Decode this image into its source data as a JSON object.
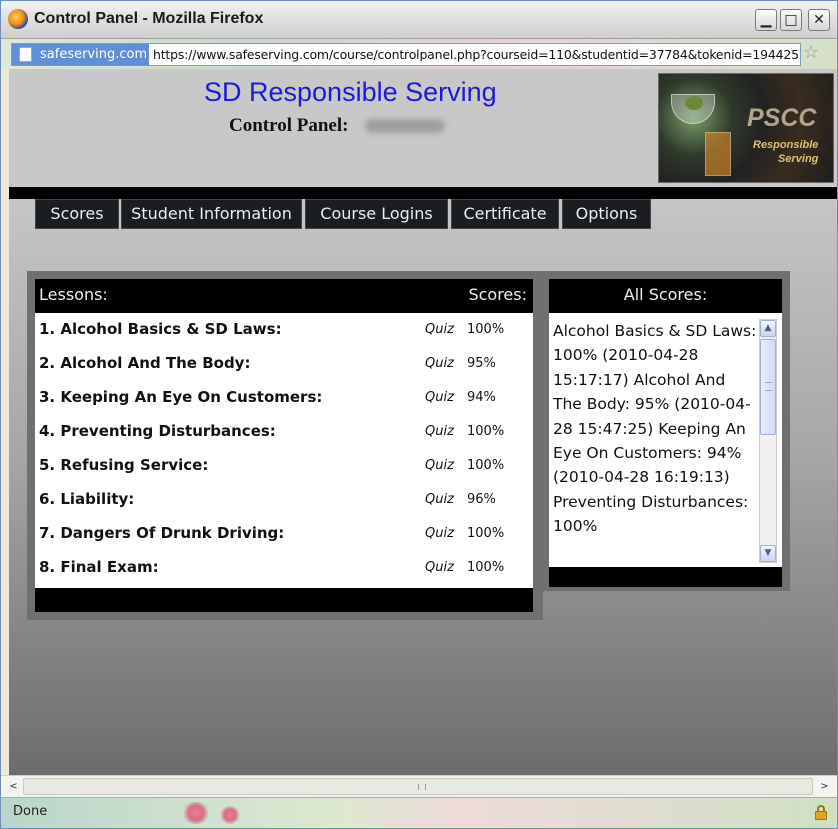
{
  "window": {
    "title": "Control Panel - Mozilla Firefox",
    "minimize_glyph": "▁",
    "maximize_glyph": "□",
    "close_glyph": "✕"
  },
  "urlbar": {
    "site_badge": "safeserving.com",
    "url": "https://www.safeserving.com/course/controlpanel.php?courseid=110&studentid=37784&tokenid=194425",
    "star_icon": "☆"
  },
  "header": {
    "site_title": "SD Responsible Serving",
    "panel_title": "Control Panel:",
    "logo": {
      "text": "PSCC",
      "sub1": "Responsible",
      "sub2": "Serving"
    }
  },
  "nav": {
    "tabs": [
      {
        "label": "Scores"
      },
      {
        "label": "Student Information"
      },
      {
        "label": "Course Logins"
      },
      {
        "label": "Certificate"
      },
      {
        "label": "Options"
      }
    ]
  },
  "lessons": {
    "header_left": "Lessons:",
    "header_right": "Scores:",
    "rows": [
      {
        "name": "1. Alcohol Basics & SD Laws:",
        "quiz": "Quiz",
        "score": "100%"
      },
      {
        "name": "2. Alcohol And The Body:",
        "quiz": "Quiz",
        "score": "95%"
      },
      {
        "name": "3. Keeping An Eye On Customers:",
        "quiz": "Quiz",
        "score": "94%"
      },
      {
        "name": "4. Preventing Disturbances:",
        "quiz": "Quiz",
        "score": "100%"
      },
      {
        "name": "5. Refusing Service:",
        "quiz": "Quiz",
        "score": "100%"
      },
      {
        "name": "6. Liability:",
        "quiz": "Quiz",
        "score": "96%"
      },
      {
        "name": "7. Dangers Of Drunk Driving:",
        "quiz": "Quiz",
        "score": "100%"
      },
      {
        "name": "8. Final Exam:",
        "quiz": "Quiz",
        "score": "100%"
      }
    ]
  },
  "all_scores": {
    "header": "All Scores:",
    "text": "Alcohol Basics & SD Laws: 100% (2010-04-28 15:17:17) Alcohol And The Body: 95% (2010-04-28 15:47:25) Keeping An Eye On Customers: 94% (2010-04-28 16:19:13) Preventing Disturbances: 100%",
    "scroll_up": "▲",
    "scroll_down": "▼"
  },
  "hscroll": {
    "left_glyph": "<",
    "right_glyph": ">"
  },
  "status": {
    "text": "Done"
  }
}
